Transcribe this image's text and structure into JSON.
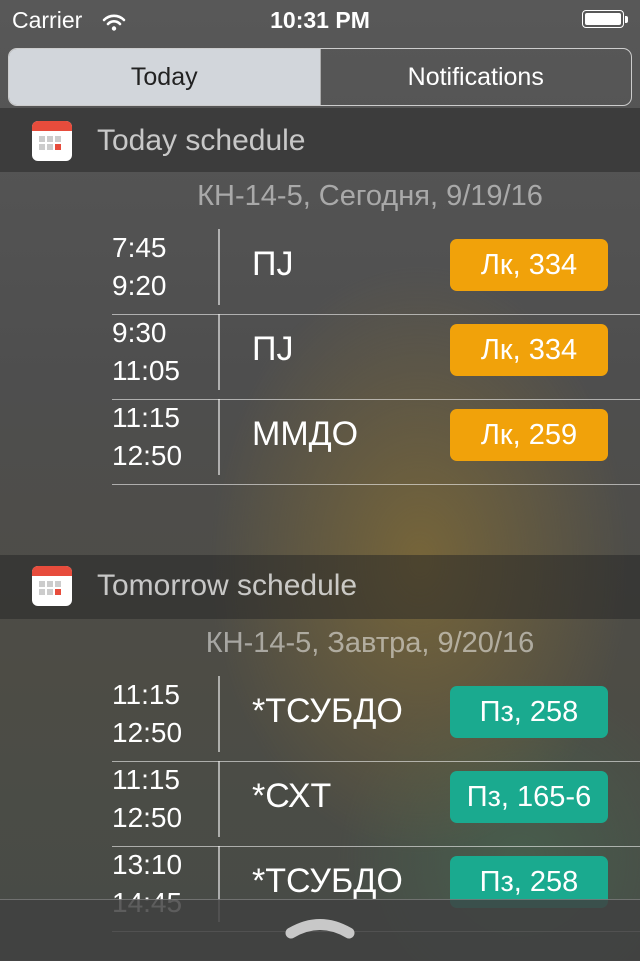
{
  "status_bar": {
    "carrier": "Carrier",
    "time": "10:31 PM"
  },
  "tabs": [
    {
      "label": "Today",
      "selected": true
    },
    {
      "label": "Notifications",
      "selected": false
    }
  ],
  "today": {
    "title": "Today schedule",
    "date_label": "КН-14-5, Сегодня, 9/19/16",
    "lessons": [
      {
        "start": "7:45",
        "end": "9:20",
        "subject": "ПЈ",
        "badge": "Лк, 334"
      },
      {
        "start": "9:30",
        "end": "11:05",
        "subject": "ПЈ",
        "badge": "Лк, 334"
      },
      {
        "start": "11:15",
        "end": "12:50",
        "subject": "ММДО",
        "badge": "Лк, 259"
      }
    ]
  },
  "tomorrow": {
    "title": "Tomorrow schedule",
    "date_label": "КН-14-5, Завтра, 9/20/16",
    "lessons": [
      {
        "start": "11:15",
        "end": "12:50",
        "subject": "*ТСУБДО",
        "badge": "Пз, 258"
      },
      {
        "start": "11:15",
        "end": "12:50",
        "subject": "*СХТ",
        "badge": "Пз, 165-6"
      },
      {
        "start": "13:10",
        "end": "14:45",
        "subject": "*ТСУБДО",
        "badge": "Пз, 258"
      }
    ]
  },
  "colors": {
    "lecture_badge": "#f1a20a",
    "practice_badge": "#1aaa8f",
    "selected_tab": "#d2d6db"
  },
  "icons": {
    "section": "calendar-icon",
    "grabber": "chevron-up-icon",
    "wifi": "wifi-icon",
    "battery": "battery-icon"
  }
}
